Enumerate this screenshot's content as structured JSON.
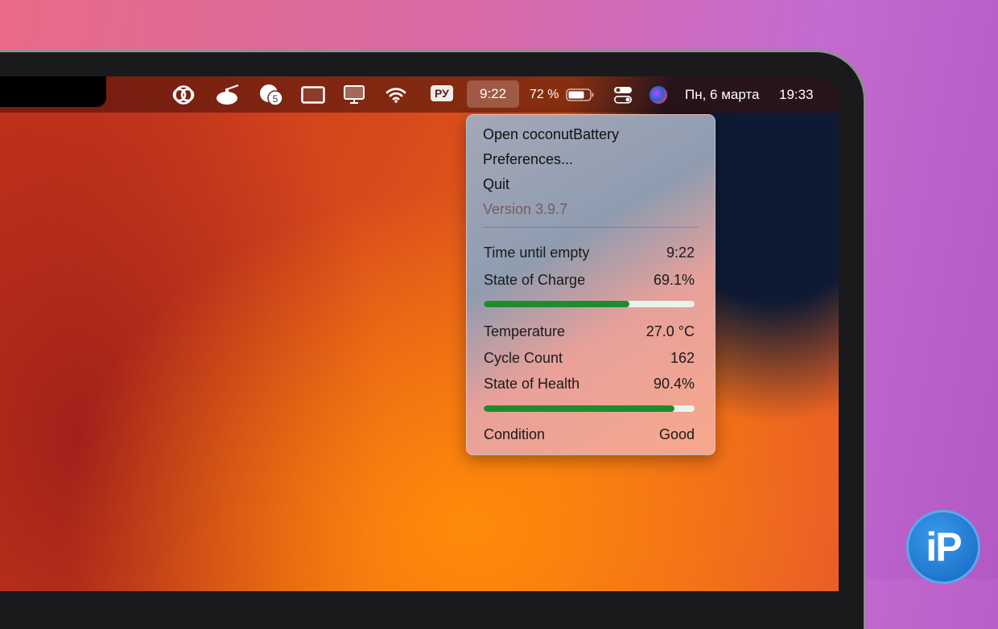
{
  "menubar": {
    "keyboard_layout": "РУ",
    "battery_time": "9:22",
    "battery_percent": "72 %",
    "date": "Пн, 6 марта",
    "time": "19:33",
    "notification_badge": "5"
  },
  "menu": {
    "items": [
      "Open coconutBattery",
      "Preferences...",
      "Quit"
    ],
    "version": "Version 3.9.7",
    "stats": {
      "time_until_empty": {
        "label": "Time until empty",
        "value": "9:22"
      },
      "state_of_charge": {
        "label": "State of Charge",
        "value": "69.1%",
        "fraction": 0.691
      },
      "temperature": {
        "label": "Temperature",
        "value": "27.0 °C"
      },
      "cycle_count": {
        "label": "Cycle Count",
        "value": "162"
      },
      "state_of_health": {
        "label": "State of Health",
        "value": "90.4%",
        "fraction": 0.904
      },
      "condition": {
        "label": "Condition",
        "value": "Good"
      }
    }
  },
  "watermark": "iP",
  "colors": {
    "bar_fill": "#1e8c2e",
    "bar_track": "#e6f4ec"
  }
}
